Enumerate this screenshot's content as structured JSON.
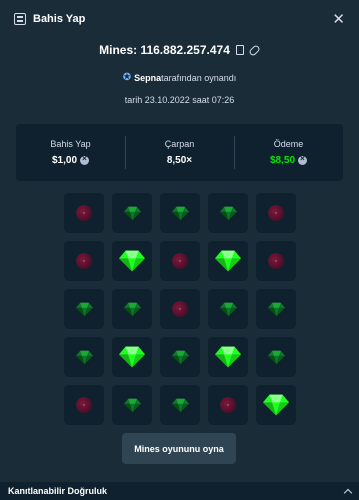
{
  "header": {
    "title": "Bahis Yap",
    "close_icon": "close-icon"
  },
  "mines_id": {
    "label": "Mines: 116.882.257.474",
    "copy_icon": "copy-icon",
    "link_icon": "link-icon"
  },
  "played_by": {
    "user": "Sepna",
    "suffix": "tarafından oynandı",
    "icon": "star-icon"
  },
  "date_text": "tarih 23.10.2022 saat 07:26",
  "stats": {
    "bet_label": "Bahis Yap",
    "bet_value": "$1,00",
    "multiplier_label": "Çarpan",
    "multiplier_value": "8,50×",
    "payout_label": "Ödeme",
    "payout_value": "$8,50"
  },
  "grid": [
    [
      "mine",
      "gem",
      "gem",
      "gem",
      "mine"
    ],
    [
      "mine",
      "gem-picked",
      "mine",
      "gem-picked",
      "mine"
    ],
    [
      "gem",
      "gem",
      "mine",
      "gem",
      "gem"
    ],
    [
      "gem",
      "gem-picked",
      "gem",
      "gem-picked",
      "gem"
    ],
    [
      "mine",
      "gem",
      "gem",
      "mine",
      "gem-picked"
    ]
  ],
  "play_button_label": "Mines oyununu oyna",
  "footer": {
    "label": "Kanıtlanabilir Doğruluk",
    "icon": "chevron-up-icon"
  },
  "colors": {
    "background": "#1a2c38",
    "panel": "#0f212e",
    "win": "#00e701",
    "gem_picked": "#1fff20",
    "gem": "#0b7a22",
    "mine": "#4a0f26"
  }
}
